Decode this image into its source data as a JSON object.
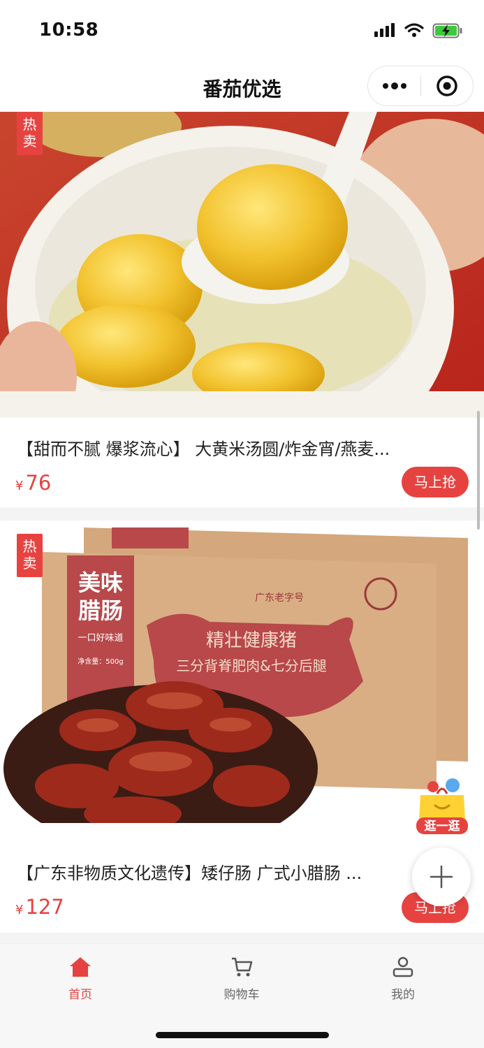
{
  "status_bar": {
    "time": "10:58"
  },
  "nav": {
    "title": "番茄优选"
  },
  "products": [
    {
      "badge": "热卖",
      "title": "【甜而不腻 爆浆流心】 大黄米汤圆/炸金宵/燕麦...",
      "currency": "¥",
      "price": "76",
      "button": "马上抢",
      "image_icon": "tangyuan-bowl-photo"
    },
    {
      "badge": "热卖",
      "title": "【广东非物质文化遗传】矮仔肠 广式小腊肠 ...",
      "currency": "¥",
      "price": "127",
      "button": "马上抢",
      "image_icon": "cantonese-sausage-box-photo",
      "image_text": [
        "美味",
        "腊肠",
        "一口好味道",
        "精壮健康猪",
        "三分背脊肥肉&七分后腿",
        "广东老字号",
        "净含量：500g"
      ]
    }
  ],
  "floating": {
    "shop_label": "逛一逛"
  },
  "tabs": [
    {
      "label": "首页",
      "icon": "home-icon",
      "active": true
    },
    {
      "label": "购物车",
      "icon": "cart-icon",
      "active": false
    },
    {
      "label": "我的",
      "icon": "user-icon",
      "active": false
    }
  ],
  "colors": {
    "accent": "#e64340",
    "battery": "#3cc93c"
  }
}
